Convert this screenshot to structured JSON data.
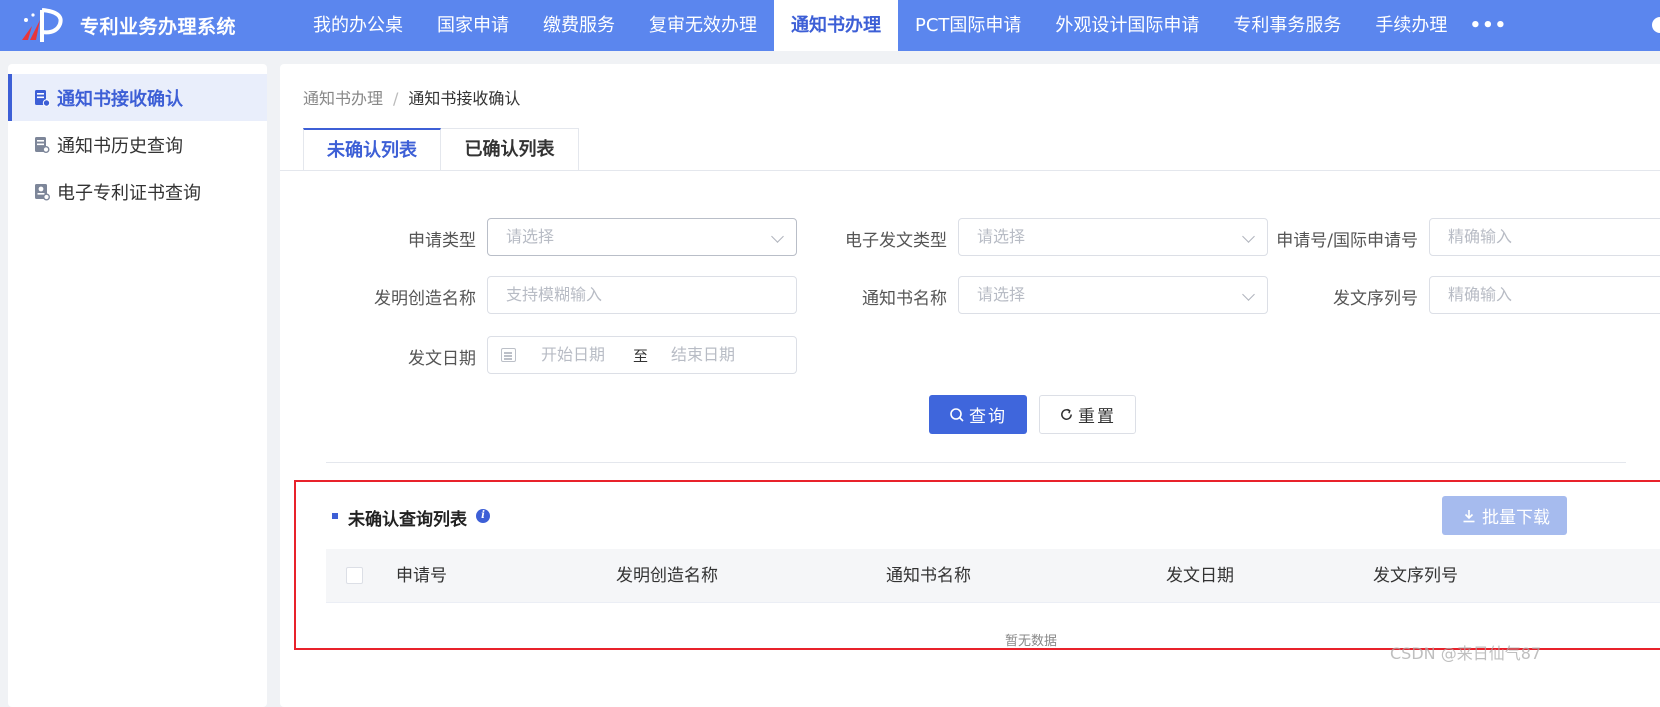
{
  "app": {
    "title": "专利业务办理系统"
  },
  "nav": {
    "items": [
      {
        "label": "我的办公桌",
        "active": false
      },
      {
        "label": "国家申请",
        "active": false
      },
      {
        "label": "缴费服务",
        "active": false
      },
      {
        "label": "复审无效办理",
        "active": false
      },
      {
        "label": "通知书办理",
        "active": true
      },
      {
        "label": "PCT国际申请",
        "active": false
      },
      {
        "label": "外观设计国际申请",
        "active": false
      },
      {
        "label": "专利事务服务",
        "active": false
      },
      {
        "label": "手续办理",
        "active": false
      }
    ],
    "more": "•••"
  },
  "sidebar": {
    "items": [
      {
        "label": "通知书接收确认",
        "active": true
      },
      {
        "label": "通知书历史查询",
        "active": false
      },
      {
        "label": "电子专利证书查询",
        "active": false
      }
    ]
  },
  "breadcrumb": {
    "parent": "通知书办理",
    "separator": "/",
    "current": "通知书接收确认"
  },
  "tabs": [
    {
      "label": "未确认列表",
      "active": true
    },
    {
      "label": "已确认列表",
      "active": false
    }
  ],
  "form": {
    "app_type": {
      "label": "申请类型",
      "placeholder": "请选择"
    },
    "doc_type": {
      "label": "电子发文类型",
      "placeholder": "请选择"
    },
    "app_no": {
      "label": "申请号/国际申请号",
      "placeholder": "精确输入"
    },
    "invention_name": {
      "label": "发明创造名称",
      "placeholder": "支持模糊输入"
    },
    "notice_name": {
      "label": "通知书名称",
      "placeholder": "请选择"
    },
    "serial_no": {
      "label": "发文序列号",
      "placeholder": "精确输入"
    },
    "date": {
      "label": "发文日期",
      "start_placeholder": "开始日期",
      "separator": "至",
      "end_placeholder": "结束日期"
    },
    "query_button": "查询",
    "reset_button": "重置"
  },
  "results": {
    "title": "未确认查询列表",
    "info": "i",
    "download_button": "批量下载",
    "columns": [
      "申请号",
      "发明创造名称",
      "通知书名称",
      "发文日期",
      "发文序列号"
    ],
    "rows": [],
    "empty_text": "暂无数据"
  },
  "watermark": "CSDN @来日仙气87",
  "colors": {
    "nav_bg": "#5b86ee",
    "accent": "#3d5fd6",
    "primary_button": "#3f66dc",
    "highlight_border": "#e8222b"
  }
}
